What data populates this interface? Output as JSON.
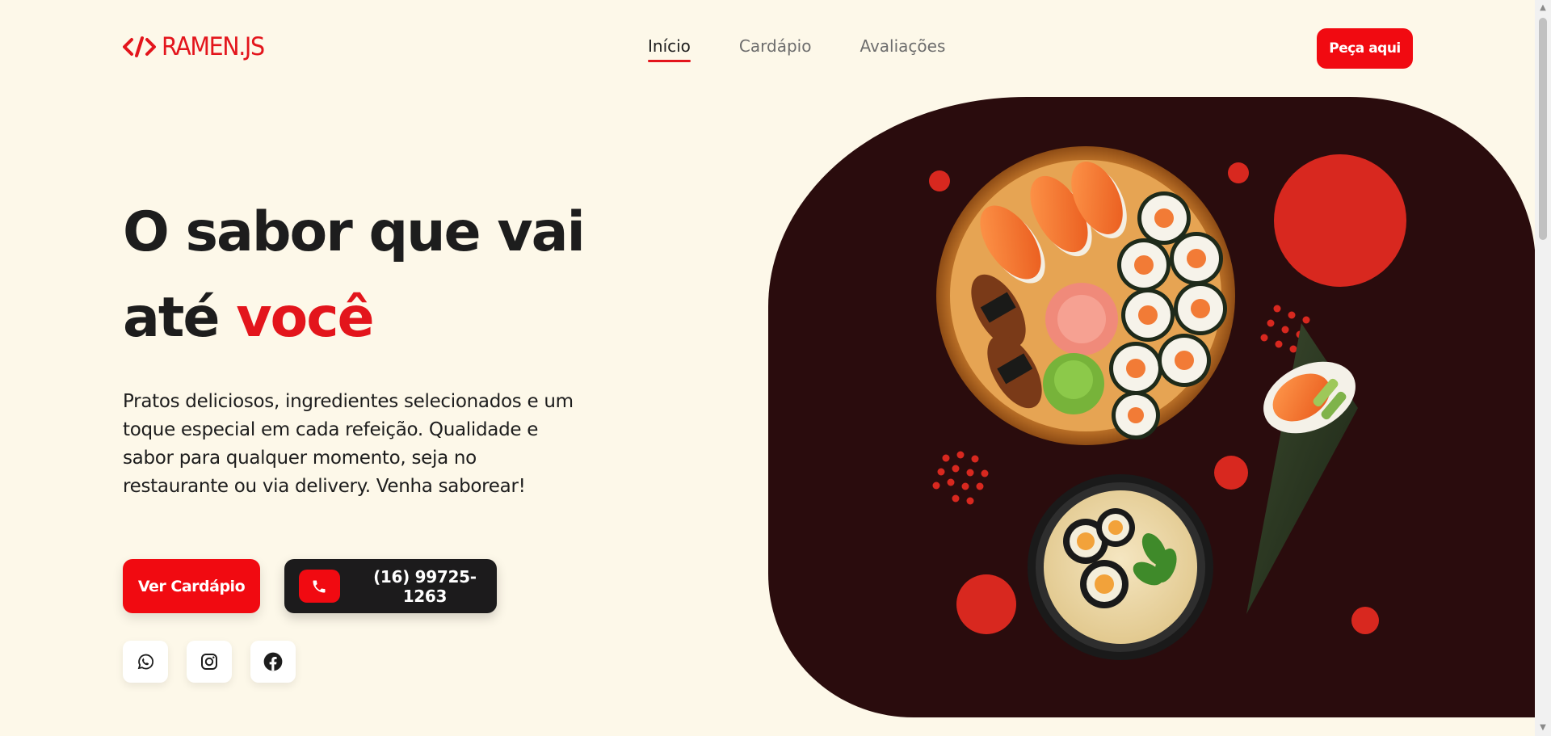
{
  "brand": {
    "logo_text": "RAMEN.JS",
    "accent_color": "#e3151c",
    "background_color": "#fdf8e9",
    "art_background_color": "#2a0c0d"
  },
  "nav": {
    "items": [
      {
        "label": "Início",
        "active": true
      },
      {
        "label": "Cardápio",
        "active": false
      },
      {
        "label": "Avaliações",
        "active": false
      }
    ]
  },
  "header": {
    "order_label": "Peça aqui"
  },
  "hero": {
    "title_line1": "O sabor que vai",
    "title_line2_prefix": "até ",
    "title_line2_accent": "você",
    "description": "Pratos deliciosos, ingredientes selecionados e um toque especial em cada refeição. Qualidade e sabor para qualquer momento, seja no restaurante ou via delivery. Venha saborear!",
    "menu_button_label": "Ver Cardápio",
    "phone_label": "(16) 99725-1263"
  },
  "socials": [
    {
      "icon": "whatsapp-icon"
    },
    {
      "icon": "instagram-icon"
    },
    {
      "icon": "facebook-icon"
    }
  ],
  "illustration": {
    "items": [
      "sushi-platter",
      "ramen-bowl",
      "temaki-cone"
    ]
  }
}
